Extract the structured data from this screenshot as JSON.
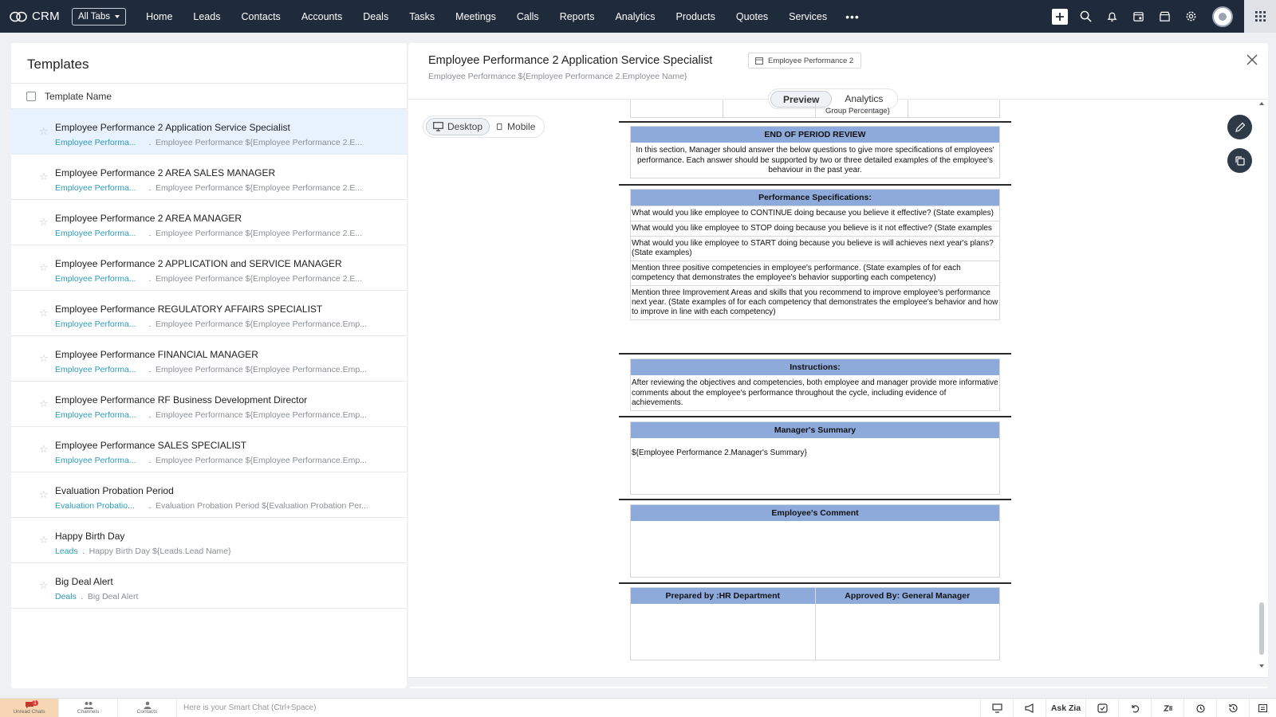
{
  "app": {
    "name": "CRM",
    "all_tabs_label": "All Tabs"
  },
  "nav": {
    "items": [
      "Home",
      "Leads",
      "Contacts",
      "Accounts",
      "Deals",
      "Tasks",
      "Meetings",
      "Calls",
      "Reports",
      "Analytics",
      "Products",
      "Quotes",
      "Services"
    ],
    "more": "•••"
  },
  "left": {
    "title": "Templates",
    "column_header": "Template Name",
    "rows": [
      {
        "name": "Employee Performance 2 Application Service Specialist",
        "module": "Employee Performa...",
        "subject": "Employee Performance ${Employee Performance 2.E...",
        "selected": true
      },
      {
        "name": "Employee Performance 2 AREA SALES MANAGER",
        "module": "Employee Performa...",
        "subject": "Employee Performance ${Employee Performance 2.E..."
      },
      {
        "name": "Employee Performance 2 AREA MANAGER",
        "module": "Employee Performa...",
        "subject": "Employee Performance ${Employee Performance 2.E..."
      },
      {
        "name": "Employee Performance 2 APPLICATION and SERVICE MANAGER",
        "module": "Employee Performa...",
        "subject": "Employee Performance ${Employee Performance 2.E..."
      },
      {
        "name": "Employee Performance REGULATORY AFFAIRS SPECIALIST",
        "module": "Employee Performa...",
        "subject": "Employee Performance ${Employee Performance.Emp..."
      },
      {
        "name": "Employee Performance FINANCIAL MANAGER",
        "module": "Employee Performa...",
        "subject": "Employee Performance ${Employee Performance.Emp..."
      },
      {
        "name": "Employee Performance RF Business Development Director",
        "module": "Employee Performa...",
        "subject": "Employee Performance ${Employee Performance.Emp..."
      },
      {
        "name": "Employee Performance SALES SPECIALIST",
        "module": "Employee Performa...",
        "subject": "Employee Performance ${Employee Performance.Emp..."
      },
      {
        "name": "Evaluation Probation Period",
        "module": "Evaluation Probatio...",
        "subject": "Evaluation Probation Period ${Evaluation Probation Per..."
      },
      {
        "name": "Happy Birth Day",
        "module": "Leads",
        "subject": "Happy Birth Day ${Leads.Lead Name}",
        "short": true
      },
      {
        "name": "Big Deal Alert",
        "module": "Deals",
        "subject": "Big Deal Alert",
        "short": true
      }
    ]
  },
  "detail": {
    "title": "Employee Performance 2 Application Service Specialist",
    "module_tag": "Employee Performance 2",
    "subject": "Employee Performance ${Employee Performance 2.Employee Name}",
    "tabs": {
      "preview": "Preview",
      "analytics": "Analytics"
    },
    "devices": {
      "desktop": "Desktop",
      "mobile": "Mobile"
    }
  },
  "doc": {
    "top_cut_text": "Group Percentage}",
    "end_review": {
      "header": "END OF PERIOD REVIEW",
      "text": "In this section, Manager should answer the below questions to give more specifications of employees' performance. Each answer should be supported by two or three detailed examples of the employee's behaviour in the past year."
    },
    "perf_spec": {
      "header": "Performance Specifications:",
      "questions": [
        "What would you like employee to CONTINUE doing because you believe it effective? (State examples)",
        "What would you like employee to STOP doing because you believe is it not effective? (State examples",
        "What would you like employee to START doing because you believe is will achieves next year's plans? (State examples)",
        "Mention three positive competencies in employee's performance. (State examples of for each competency that demonstrates the employee's behavior supporting each competency)",
        "Mention three Improvement Areas and skills that you recommend to improve employee's performance next year. (State examples of for each competency that demonstrates the employee's behavior and how to improve in line with each competency)"
      ]
    },
    "instructions": {
      "header": "Instructions:",
      "text": "After reviewing the objectives and competencies, both employee and manager provide more informative comments about the employee's performance throughout the cycle, including evidence of achievements."
    },
    "manager_summary": {
      "header": "Manager's Summary",
      "text": "${Employee Performance 2.Manager's Summary}"
    },
    "employee_comment": {
      "header": "Employee's Comment"
    },
    "signoff": {
      "prepared": "Prepared by :HR Department",
      "approved": "Approved By: General Manager"
    }
  },
  "bottombar": {
    "unread_chats": "Unread Chats",
    "channels": "Channels",
    "contacts": "Contacts",
    "smart_chat_placeholder": "Here is your Smart Chat (Ctrl+Space)",
    "ask_zia": "Ask Zia",
    "unread_count": "1"
  },
  "colors": {
    "topbar": "#1f2a3a",
    "section_header": "#8eaadb",
    "module_link": "#2b9bb8",
    "selected_row": "#e8f2fd"
  }
}
